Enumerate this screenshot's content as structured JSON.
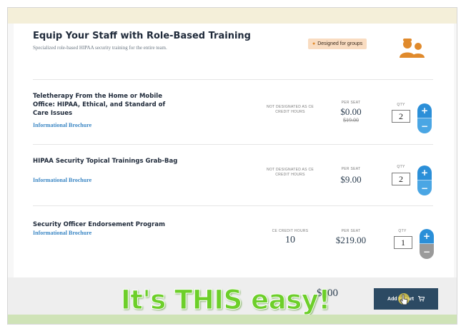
{
  "header": {
    "title": "Equip Your Staff with Role-Based Training",
    "subtitle": "Specialized role-based HIPAA security training for the entire team.",
    "badge": "Designed for groups",
    "badge_icon": "people-icon",
    "group_icon": "group-users-icon"
  },
  "courses": [
    {
      "title": "Teletherapy From the Home or Mobile Office: HIPAA, Ethical, and Standard of Care Issues",
      "brochure": "Informational Brochure",
      "ce_label": "NOT DESIGNATED AS CE CREDIT HOURS",
      "seat_label": "PER SEAT",
      "price": "$0.00",
      "old_price": "$19.00",
      "qty_label": "QTY",
      "qty": "2"
    },
    {
      "title": "HIPAA Security Topical Trainings Grab-Bag",
      "brochure": "Informational Brochure",
      "ce_label": "NOT DESIGNATED AS CE CREDIT HOURS",
      "seat_label": "PER SEAT",
      "price": "$9.00",
      "qty_label": "QTY",
      "qty": "2"
    },
    {
      "title": "Security Officer Endorsement Program",
      "brochure": "Informational Brochure",
      "ce_label": "CE CREDIT HOURS",
      "ce_value": "10",
      "seat_label": "PER SEAT",
      "price": "$219.00",
      "qty_label": "QTY",
      "qty": "1"
    }
  ],
  "footer": {
    "total": "$ .00",
    "add_to_cart": "Add to cart",
    "cart_icon": "cart-icon"
  },
  "overlay": {
    "caption": "It's THIS easy!"
  },
  "colors": {
    "accent_blue": "#2b8fd8",
    "badge_bg": "#f9dcc1",
    "badge_icon": "#e08a2c",
    "button_navy": "#2c4a63",
    "caption_green": "#6dcf2a"
  }
}
